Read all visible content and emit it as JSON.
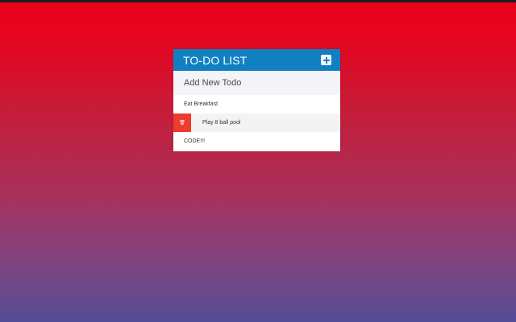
{
  "app": {
    "title": "TO-DO LIST",
    "add_icon": "plus-square-icon"
  },
  "input": {
    "placeholder": "Add New Todo",
    "value": ""
  },
  "todos": [
    {
      "text": "Eat Breakfast",
      "delete_visible": false
    },
    {
      "text": "Play 8 ball pool",
      "delete_visible": true,
      "delete_icon": "trash-icon",
      "delete_glyph": "🗑"
    },
    {
      "text": "CODE!!!",
      "delete_visible": false
    }
  ],
  "colors": {
    "header": "#1180c2",
    "delete": "#ee3b2c",
    "gradient_top": "#ea0019",
    "gradient_bottom": "#534d96"
  }
}
